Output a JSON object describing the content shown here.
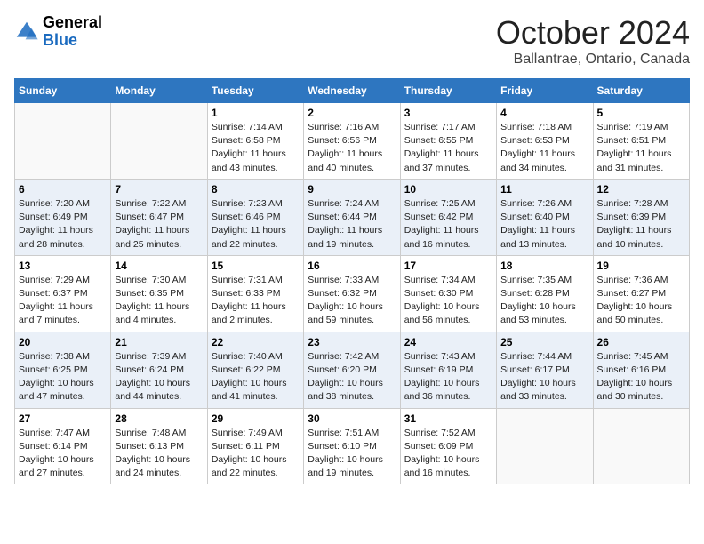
{
  "header": {
    "logo_general": "General",
    "logo_blue": "Blue",
    "month_title": "October 2024",
    "location": "Ballantrae, Ontario, Canada"
  },
  "columns": [
    "Sunday",
    "Monday",
    "Tuesday",
    "Wednesday",
    "Thursday",
    "Friday",
    "Saturday"
  ],
  "weeks": [
    [
      {
        "day": "",
        "sunrise": "",
        "sunset": "",
        "daylight": ""
      },
      {
        "day": "",
        "sunrise": "",
        "sunset": "",
        "daylight": ""
      },
      {
        "day": "1",
        "sunrise": "Sunrise: 7:14 AM",
        "sunset": "Sunset: 6:58 PM",
        "daylight": "Daylight: 11 hours and 43 minutes."
      },
      {
        "day": "2",
        "sunrise": "Sunrise: 7:16 AM",
        "sunset": "Sunset: 6:56 PM",
        "daylight": "Daylight: 11 hours and 40 minutes."
      },
      {
        "day": "3",
        "sunrise": "Sunrise: 7:17 AM",
        "sunset": "Sunset: 6:55 PM",
        "daylight": "Daylight: 11 hours and 37 minutes."
      },
      {
        "day": "4",
        "sunrise": "Sunrise: 7:18 AM",
        "sunset": "Sunset: 6:53 PM",
        "daylight": "Daylight: 11 hours and 34 minutes."
      },
      {
        "day": "5",
        "sunrise": "Sunrise: 7:19 AM",
        "sunset": "Sunset: 6:51 PM",
        "daylight": "Daylight: 11 hours and 31 minutes."
      }
    ],
    [
      {
        "day": "6",
        "sunrise": "Sunrise: 7:20 AM",
        "sunset": "Sunset: 6:49 PM",
        "daylight": "Daylight: 11 hours and 28 minutes."
      },
      {
        "day": "7",
        "sunrise": "Sunrise: 7:22 AM",
        "sunset": "Sunset: 6:47 PM",
        "daylight": "Daylight: 11 hours and 25 minutes."
      },
      {
        "day": "8",
        "sunrise": "Sunrise: 7:23 AM",
        "sunset": "Sunset: 6:46 PM",
        "daylight": "Daylight: 11 hours and 22 minutes."
      },
      {
        "day": "9",
        "sunrise": "Sunrise: 7:24 AM",
        "sunset": "Sunset: 6:44 PM",
        "daylight": "Daylight: 11 hours and 19 minutes."
      },
      {
        "day": "10",
        "sunrise": "Sunrise: 7:25 AM",
        "sunset": "Sunset: 6:42 PM",
        "daylight": "Daylight: 11 hours and 16 minutes."
      },
      {
        "day": "11",
        "sunrise": "Sunrise: 7:26 AM",
        "sunset": "Sunset: 6:40 PM",
        "daylight": "Daylight: 11 hours and 13 minutes."
      },
      {
        "day": "12",
        "sunrise": "Sunrise: 7:28 AM",
        "sunset": "Sunset: 6:39 PM",
        "daylight": "Daylight: 11 hours and 10 minutes."
      }
    ],
    [
      {
        "day": "13",
        "sunrise": "Sunrise: 7:29 AM",
        "sunset": "Sunset: 6:37 PM",
        "daylight": "Daylight: 11 hours and 7 minutes."
      },
      {
        "day": "14",
        "sunrise": "Sunrise: 7:30 AM",
        "sunset": "Sunset: 6:35 PM",
        "daylight": "Daylight: 11 hours and 4 minutes."
      },
      {
        "day": "15",
        "sunrise": "Sunrise: 7:31 AM",
        "sunset": "Sunset: 6:33 PM",
        "daylight": "Daylight: 11 hours and 2 minutes."
      },
      {
        "day": "16",
        "sunrise": "Sunrise: 7:33 AM",
        "sunset": "Sunset: 6:32 PM",
        "daylight": "Daylight: 10 hours and 59 minutes."
      },
      {
        "day": "17",
        "sunrise": "Sunrise: 7:34 AM",
        "sunset": "Sunset: 6:30 PM",
        "daylight": "Daylight: 10 hours and 56 minutes."
      },
      {
        "day": "18",
        "sunrise": "Sunrise: 7:35 AM",
        "sunset": "Sunset: 6:28 PM",
        "daylight": "Daylight: 10 hours and 53 minutes."
      },
      {
        "day": "19",
        "sunrise": "Sunrise: 7:36 AM",
        "sunset": "Sunset: 6:27 PM",
        "daylight": "Daylight: 10 hours and 50 minutes."
      }
    ],
    [
      {
        "day": "20",
        "sunrise": "Sunrise: 7:38 AM",
        "sunset": "Sunset: 6:25 PM",
        "daylight": "Daylight: 10 hours and 47 minutes."
      },
      {
        "day": "21",
        "sunrise": "Sunrise: 7:39 AM",
        "sunset": "Sunset: 6:24 PM",
        "daylight": "Daylight: 10 hours and 44 minutes."
      },
      {
        "day": "22",
        "sunrise": "Sunrise: 7:40 AM",
        "sunset": "Sunset: 6:22 PM",
        "daylight": "Daylight: 10 hours and 41 minutes."
      },
      {
        "day": "23",
        "sunrise": "Sunrise: 7:42 AM",
        "sunset": "Sunset: 6:20 PM",
        "daylight": "Daylight: 10 hours and 38 minutes."
      },
      {
        "day": "24",
        "sunrise": "Sunrise: 7:43 AM",
        "sunset": "Sunset: 6:19 PM",
        "daylight": "Daylight: 10 hours and 36 minutes."
      },
      {
        "day": "25",
        "sunrise": "Sunrise: 7:44 AM",
        "sunset": "Sunset: 6:17 PM",
        "daylight": "Daylight: 10 hours and 33 minutes."
      },
      {
        "day": "26",
        "sunrise": "Sunrise: 7:45 AM",
        "sunset": "Sunset: 6:16 PM",
        "daylight": "Daylight: 10 hours and 30 minutes."
      }
    ],
    [
      {
        "day": "27",
        "sunrise": "Sunrise: 7:47 AM",
        "sunset": "Sunset: 6:14 PM",
        "daylight": "Daylight: 10 hours and 27 minutes."
      },
      {
        "day": "28",
        "sunrise": "Sunrise: 7:48 AM",
        "sunset": "Sunset: 6:13 PM",
        "daylight": "Daylight: 10 hours and 24 minutes."
      },
      {
        "day": "29",
        "sunrise": "Sunrise: 7:49 AM",
        "sunset": "Sunset: 6:11 PM",
        "daylight": "Daylight: 10 hours and 22 minutes."
      },
      {
        "day": "30",
        "sunrise": "Sunrise: 7:51 AM",
        "sunset": "Sunset: 6:10 PM",
        "daylight": "Daylight: 10 hours and 19 minutes."
      },
      {
        "day": "31",
        "sunrise": "Sunrise: 7:52 AM",
        "sunset": "Sunset: 6:09 PM",
        "daylight": "Daylight: 10 hours and 16 minutes."
      },
      {
        "day": "",
        "sunrise": "",
        "sunset": "",
        "daylight": ""
      },
      {
        "day": "",
        "sunrise": "",
        "sunset": "",
        "daylight": ""
      }
    ]
  ]
}
